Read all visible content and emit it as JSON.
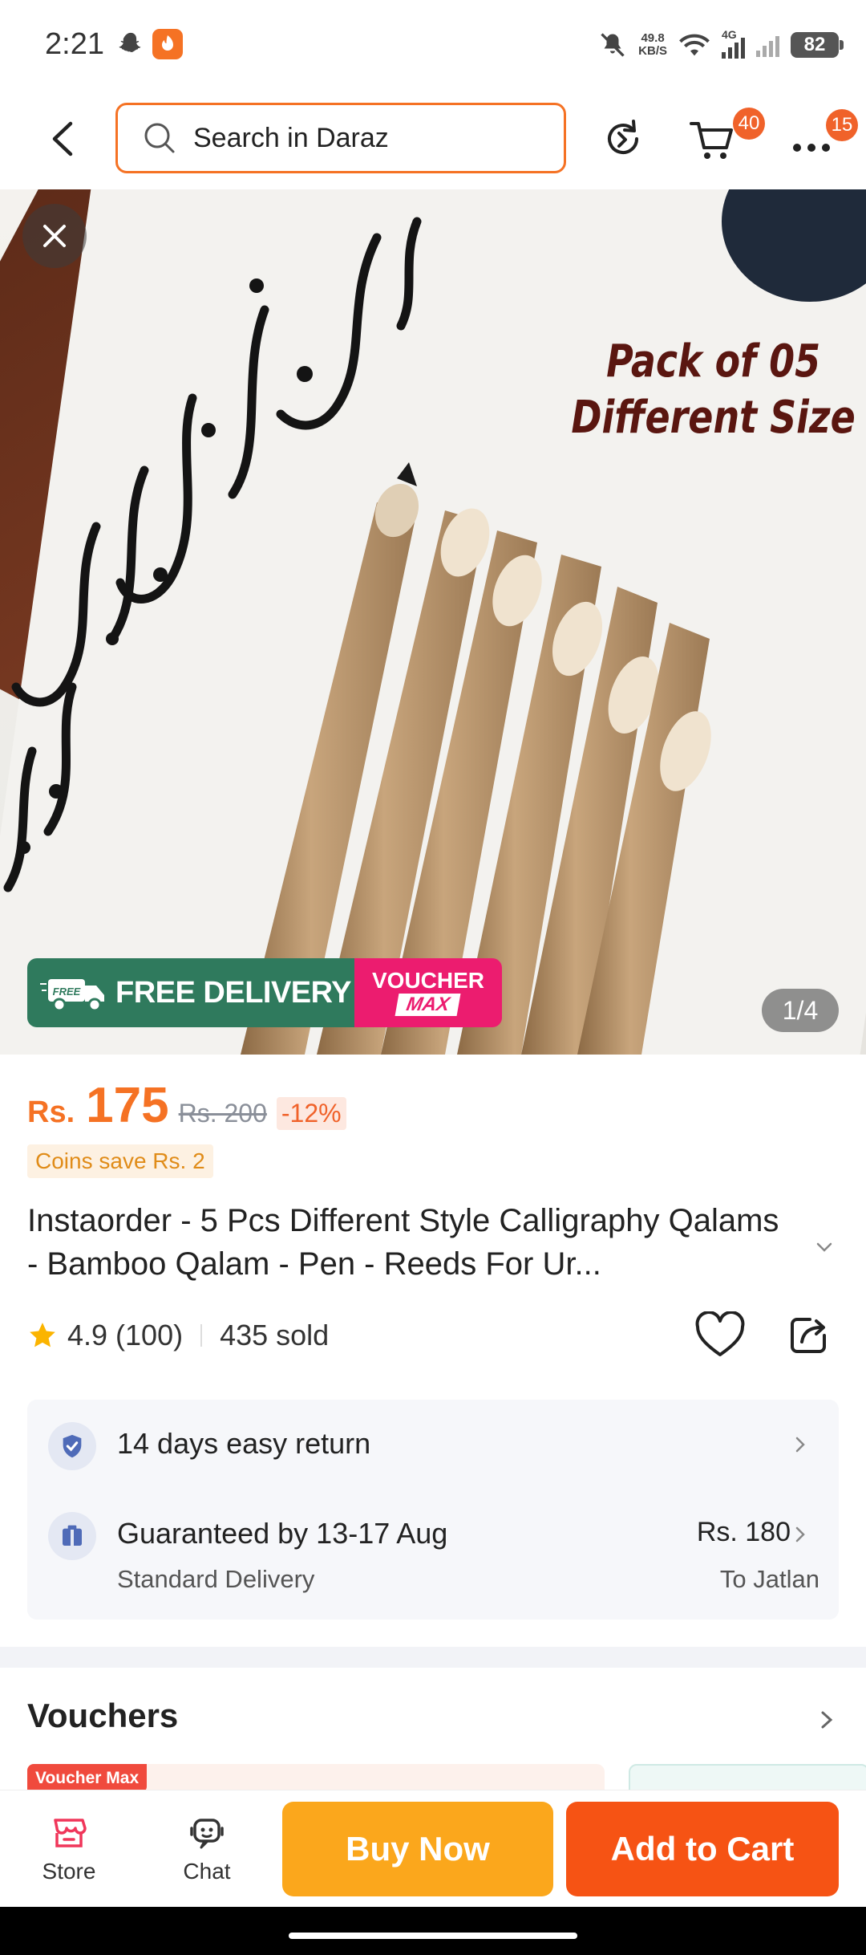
{
  "status_bar": {
    "time": "2:21",
    "net_speed_value": "49.8",
    "net_speed_unit": "KB/S",
    "network_type": "4G",
    "battery": "82"
  },
  "header": {
    "search_placeholder": "Search in Daraz",
    "cart_count": "40",
    "more_count": "15"
  },
  "gallery": {
    "overlay_text_line1": "Pack of 05",
    "overlay_text_line2": "Different Size",
    "free_delivery_badge_small": "FREE",
    "free_delivery_label": "FREE DELIVERY",
    "voucher_max_top": "VOUCHER",
    "voucher_max_bottom": "MAX",
    "counter": "1/4"
  },
  "product": {
    "currency": "Rs.",
    "price": "175",
    "original_price": "Rs. 200",
    "discount": "-12%",
    "coins_note": "Coins save Rs. 2",
    "title": "Instaorder - 5 Pcs Different Style Calligraphy Qalams - Bamboo Qalam - Pen - Reeds For Ur...",
    "rating": "4.9",
    "reviews": "(100)",
    "sold": "435 sold"
  },
  "services": {
    "return_policy": "14 days easy return",
    "delivery_guarantee": "Guaranteed by 13-17 Aug",
    "delivery_type": "Standard Delivery",
    "delivery_fee": "Rs. 180",
    "delivery_location": "To Jatlan"
  },
  "vouchers": {
    "title": "Vouchers",
    "voucher_max_tag": "Voucher Max"
  },
  "bottom_bar": {
    "store_label": "Store",
    "chat_label": "Chat",
    "buy_now_label": "Buy Now",
    "add_to_cart_label": "Add to Cart"
  },
  "colors": {
    "brand_orange": "#f57224",
    "buy_now": "#fba71c",
    "add_to_cart": "#f65314",
    "free_delivery_green": "#2f7a5d",
    "voucher_pink": "#ec1c6f"
  }
}
